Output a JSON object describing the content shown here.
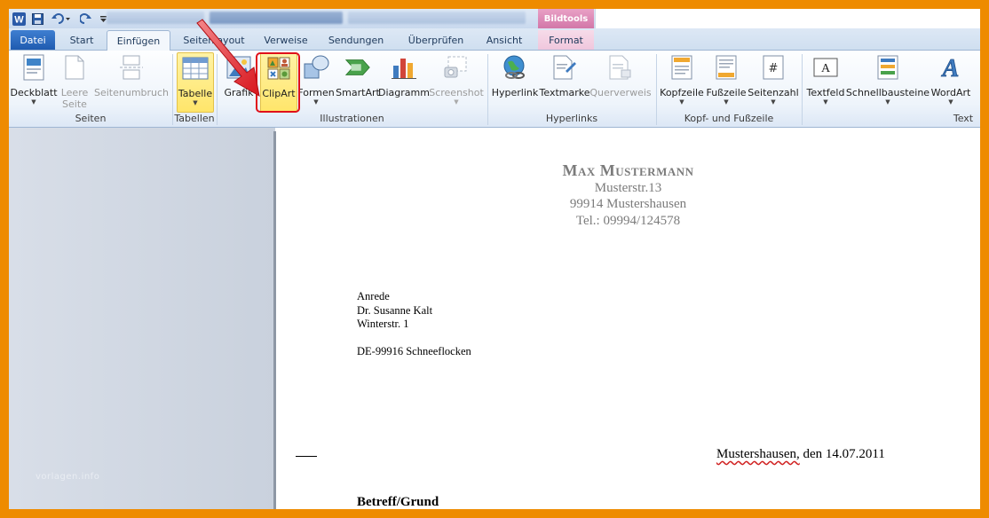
{
  "titlebar": {
    "contextual_group": "Bildtools"
  },
  "tabs": [
    {
      "label": "Datei"
    },
    {
      "label": "Start"
    },
    {
      "label": "Einfügen"
    },
    {
      "label": "Seitenlayout"
    },
    {
      "label": "Verweise"
    },
    {
      "label": "Sendungen"
    },
    {
      "label": "Überprüfen"
    },
    {
      "label": "Ansicht"
    },
    {
      "label": "Format"
    }
  ],
  "ribbon": {
    "groups": {
      "seiten": "Seiten",
      "tabellen": "Tabellen",
      "illustrationen": "Illustrationen",
      "hyperlinks": "Hyperlinks",
      "kopf_fusszeile": "Kopf- und Fußzeile",
      "text": "Text"
    },
    "buttons": {
      "deckblatt": "Deckblatt",
      "leere_seite_1": "Leere",
      "leere_seite_2": "Seite",
      "seitenumbruch": "Seitenumbruch",
      "tabelle": "Tabelle",
      "grafik": "Grafik",
      "clipart": "ClipArt",
      "formen": "Formen",
      "smartart": "SmartArt",
      "diagramm": "Diagramm",
      "screenshot": "Screenshot",
      "hyperlink": "Hyperlink",
      "textmarke": "Textmarke",
      "querverweis": "Querverweis",
      "kopfzeile": "Kopfzeile",
      "fusszeile": "Fußzeile",
      "seitenzahl": "Seitenzahl",
      "textfeld": "Textfeld",
      "schnellbausteine": "Schnellbausteine",
      "wordart": "WordArt"
    }
  },
  "document": {
    "sender_name": "Max Mustermann",
    "sender_street": "Musterstr.13",
    "sender_city": "99914 Mustershausen",
    "sender_phone": "Tel.:  09994/124578",
    "recipient": {
      "salutation": "Anrede",
      "name": "Dr.  Susanne Kalt",
      "street": "Winterstr.  1",
      "city": "DE-99916 Schneeflocken"
    },
    "date_city": "Mustershausen,",
    "date_rest": " den 14.07.2011",
    "subject": "Betreff/Grund"
  },
  "watermark": "vorlagen.info",
  "colors": {
    "frame": "#ee8b00",
    "highlight_box": "#e0101a",
    "datei_tab": "#2a66bd",
    "bildtools": "#d87fae"
  }
}
